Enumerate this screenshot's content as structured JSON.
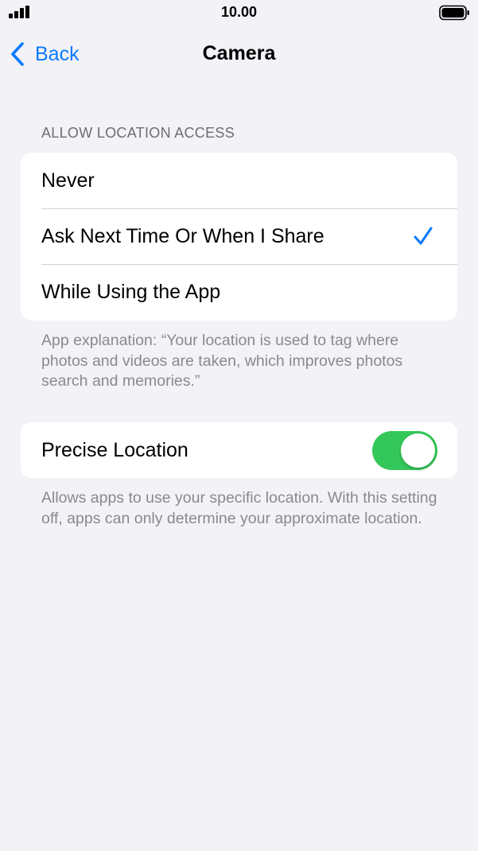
{
  "status_bar": {
    "time": "10.00"
  },
  "nav": {
    "back_label": "Back",
    "title": "Camera"
  },
  "location_access": {
    "header": "ALLOW LOCATION ACCESS",
    "options": [
      {
        "label": "Never",
        "selected": false
      },
      {
        "label": "Ask Next Time Or When I Share",
        "selected": true
      },
      {
        "label": "While Using the App",
        "selected": false
      }
    ],
    "explanation": "App explanation: “Your location is used to tag where photos and videos are taken, which improves photos search and memories.”"
  },
  "precise_location": {
    "label": "Precise Location",
    "enabled": true,
    "note": "Allows apps to use your specific location. With this setting off, apps can only determine your approximate location."
  },
  "colors": {
    "accent": "#0a7aff",
    "toggle_on": "#34c759",
    "background": "#f2f2f7"
  }
}
